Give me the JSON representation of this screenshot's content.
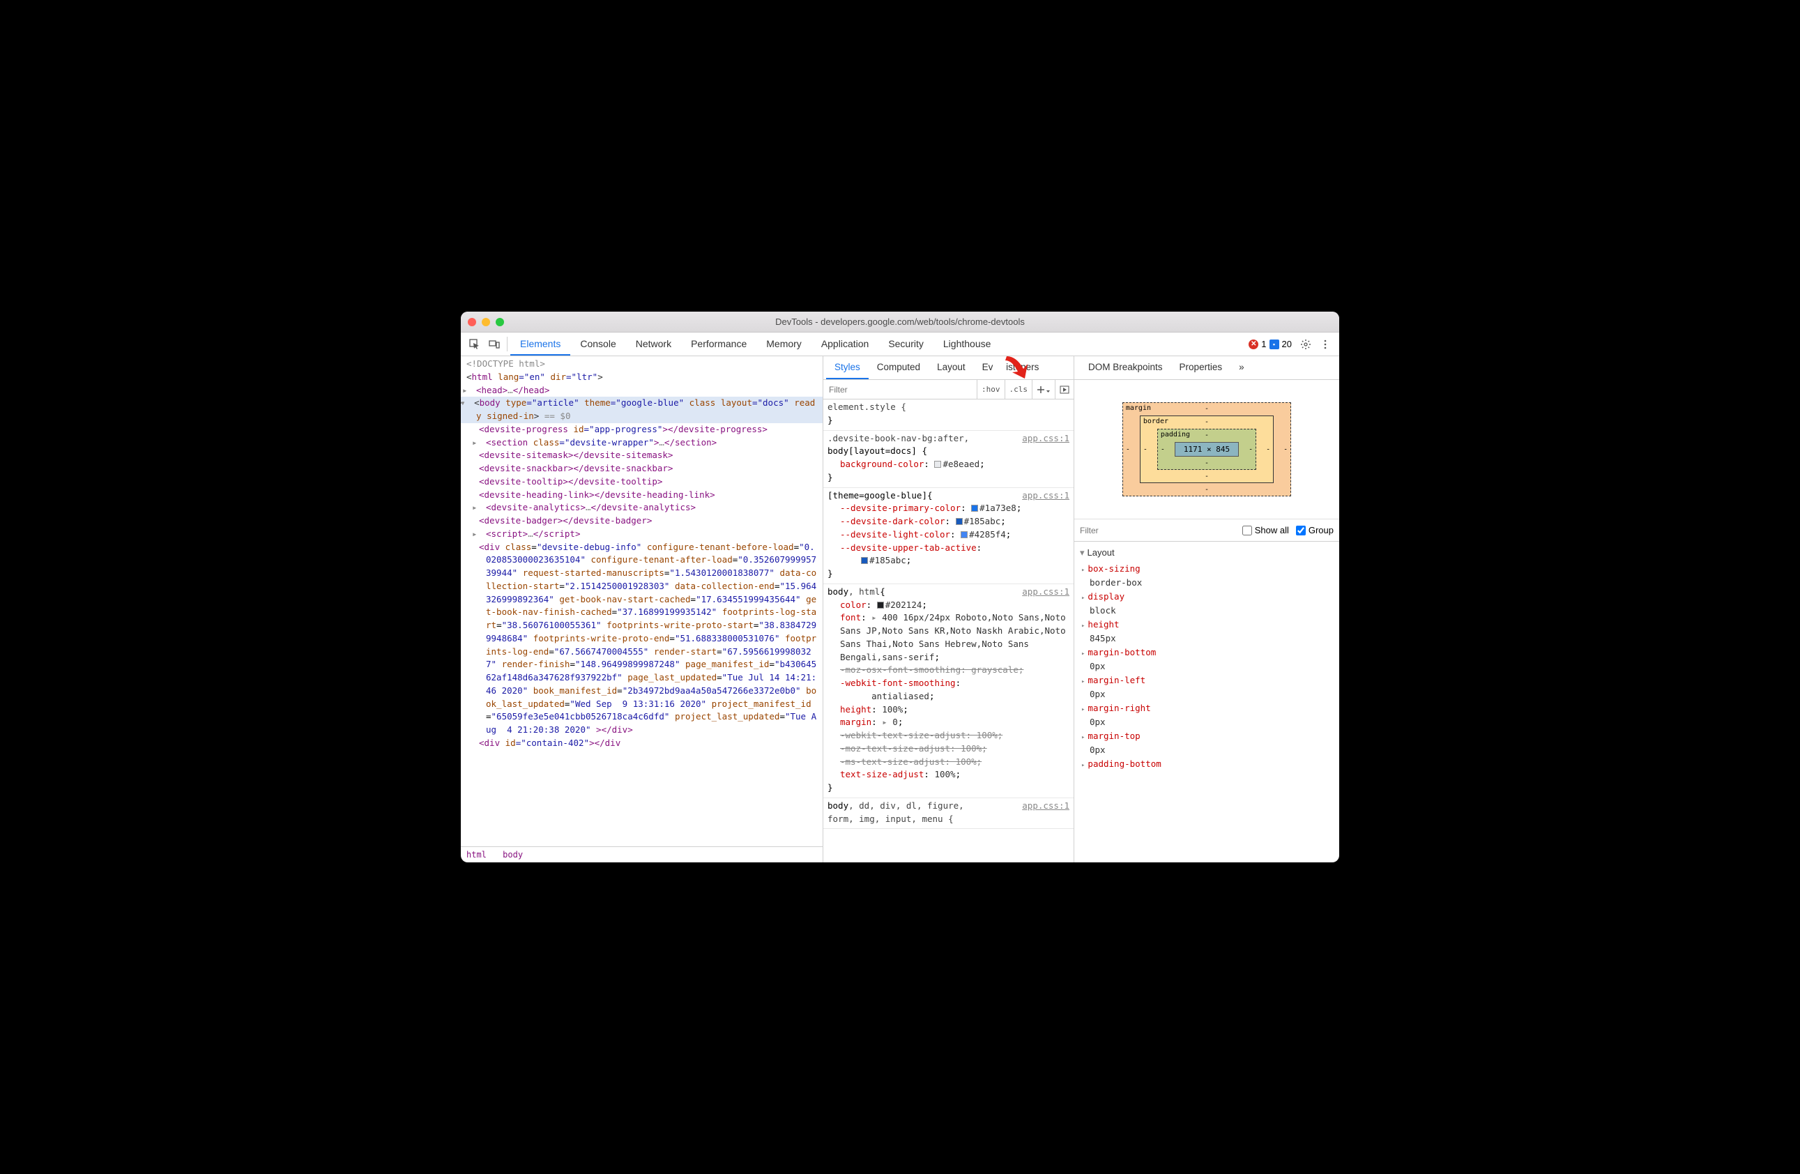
{
  "window": {
    "title": "DevTools - developers.google.com/web/tools/chrome-devtools"
  },
  "status": {
    "errors": "1",
    "messages": "20"
  },
  "maintabs": [
    "Elements",
    "Console",
    "Network",
    "Performance",
    "Memory",
    "Application",
    "Security",
    "Lighthouse"
  ],
  "subtabs": [
    "Styles",
    "Computed",
    "Layout",
    "Event Listeners",
    "DOM Breakpoints",
    "Properties"
  ],
  "filter_placeholder": "Filter",
  "toolbar": {
    "hov": ":hov",
    "cls": ".cls"
  },
  "crumbs": [
    "html",
    "body"
  ],
  "dom": {
    "l0": "<!DOCTYPE html>",
    "l1_open": "<",
    "l1_tag": "html",
    "l1_a1": " lang",
    "l1_v1": "=\"en\"",
    "l1_a2": " dir",
    "l1_v2": "=\"ltr\"",
    "l1_close": ">",
    "l2": "<head>…</head>",
    "l3_open": "<",
    "l3_tag": "body",
    "l3_a1": " type",
    "l3_v1": "=\"article\"",
    "l3_a2": " theme",
    "l3_v2": "=\"google-blue\" ",
    "l3_a3": "class layout=\"docs\" ready signed-in",
    "l3_end": "> == $0",
    "l4": "<devsite-progress id=\"app-progress\"></devsite-progress>",
    "l5": "<section class=\"devsite-wrapper\">…</section>",
    "l6": "<devsite-sitemask></devsite-sitemask>",
    "l7": "<devsite-snackbar></devsite-snackbar>",
    "l8": "<devsite-tooltip></devsite-tooltip>",
    "l9": "<devsite-heading-link></devsite-heading-link>",
    "l10": "<devsite-analytics>…</devsite-analytics>",
    "l11": "<devsite-badger></devsite-badger>",
    "l12": "<script>…</script>",
    "l13": "<div class=\"devsite-debug-info\" configure-tenant-before-load=\"0.020853000023635104\" configure-tenant-after-load=\"0.35260799995739944\" request-started-manuscripts=\"1.5430120001838077\" data-collection-start=\"2.1514250001928303\" data-collection-end=\"15.964326999892364\" get-book-nav-start-cached=\"17.634551999435644\" get-book-nav-finish-cached=\"37.16899199935142\" footprints-log-start=\"38.56076100055361\" footprints-write-proto-start=\"38.83847299948684\" footprints-write-proto-end=\"51.688338000531076\" footprints-log-end=\"67.5667470004555\" render-start=\"67.59566199980327\" render-finish=\"148.96499899987248\" page_manifest_id=\"b43064562af148d6a347628f937922bf\" page_last_updated=\"Tue Jul 14 14:21:46 2020\" book_manifest_id=\"2b34972bd9aa4a50a547266e3372e0b0\" book_last_updated=\"Wed Sep  9 13:31:16 2020\" project_manifest_id=\"65059fe3e5e041cbb0526718ca4c6dfd\" project_last_updated=\"Tue Aug  4 21:20:38 2020\"></div>",
    "l14": "<div id=\"contain-402\"></div"
  },
  "styles": {
    "r0": {
      "sel": "element.style {",
      "close": "}"
    },
    "r1": {
      "sel": ".devsite-book-nav-bg:after, body[layout=docs] {",
      "link": "app.css:1",
      "p1n": "background-color",
      "p1v": "#e8eaed",
      "close": "}"
    },
    "r2": {
      "sel": "[theme=google-blue] {",
      "link": "app.css:1",
      "p1n": "--devsite-primary-color",
      "p1v": "#1a73e8",
      "p2n": "--devsite-dark-color",
      "p2v": "#185abc",
      "p3n": "--devsite-light-color",
      "p3v": "#4285f4",
      "p4n": "--devsite-upper-tab-active",
      "p4v": "#185abc",
      "close": "}"
    },
    "r3": {
      "sel": "body, html {",
      "link": "app.css:1",
      "p1n": "color",
      "p1v": "#202124",
      "p2n": "font",
      "p2v": "400 16px/24px Roboto,Noto Sans,Noto Sans JP,Noto Sans KR,Noto Naskh Arabic,Noto Sans Thai,Noto Sans Hebrew,Noto Sans Bengali,sans-serif",
      "p3": "-moz-osx-font-smoothing: grayscale;",
      "p4n": "-webkit-font-smoothing",
      "p4v": "antialiased",
      "p5n": "height",
      "p5v": "100%",
      "p6n": "margin",
      "p6v": "0",
      "p7": "-webkit-text-size-adjust: 100%;",
      "p8": "-moz-text-size-adjust: 100%;",
      "p9": "-ms-text-size-adjust: 100%;",
      "p10n": "text-size-adjust",
      "p10v": "100%",
      "close": "}"
    },
    "r4": {
      "sel": "body, dd, div, dl, figure, form, img, input, menu {",
      "link": "app.css:1"
    }
  },
  "boxmodel": {
    "margin": "margin",
    "border": "border",
    "padding": "padding",
    "content": "1171 × 845",
    "dash": "-"
  },
  "compfilter": {
    "placeholder": "Filter",
    "showall": "Show all",
    "group": "Group"
  },
  "computed": {
    "grouphead": "Layout",
    "props": [
      {
        "n": "box-sizing",
        "v": "border-box"
      },
      {
        "n": "display",
        "v": "block"
      },
      {
        "n": "height",
        "v": "845px"
      },
      {
        "n": "margin-bottom",
        "v": "0px"
      },
      {
        "n": "margin-left",
        "v": "0px"
      },
      {
        "n": "margin-right",
        "v": "0px"
      },
      {
        "n": "margin-top",
        "v": "0px"
      },
      {
        "n": "padding-bottom",
        "v": ""
      }
    ]
  }
}
